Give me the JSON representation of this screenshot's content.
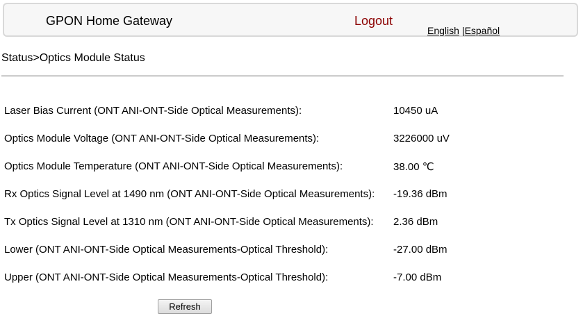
{
  "header": {
    "title": "GPON Home Gateway",
    "logout": "Logout",
    "lang_english": "English",
    "lang_sep": "|",
    "lang_espanol": "Español"
  },
  "breadcrumb": "Status>Optics Module Status",
  "rows": [
    {
      "label": "Laser Bias Current (ONT ANI-ONT-Side Optical Measurements):",
      "value": "10450 uA"
    },
    {
      "label": "Optics Module Voltage (ONT ANI-ONT-Side Optical Measurements):",
      "value": "3226000 uV"
    },
    {
      "label": "Optics Module Temperature (ONT ANI-ONT-Side Optical Measurements):",
      "value": "38.00 ℃"
    },
    {
      "label": "Rx Optics Signal Level at 1490 nm (ONT ANI-ONT-Side Optical Measurements):",
      "value": "-19.36 dBm"
    },
    {
      "label": "Tx Optics Signal Level at 1310 nm (ONT ANI-ONT-Side Optical Measurements):",
      "value": "2.36 dBm"
    },
    {
      "label": "Lower (ONT ANI-ONT-Side Optical Measurements-Optical Threshold):",
      "value": "-27.00 dBm"
    },
    {
      "label": "Upper (ONT ANI-ONT-Side Optical Measurements-Optical Threshold):",
      "value": "-7.00 dBm"
    }
  ],
  "refresh_label": "Refresh"
}
